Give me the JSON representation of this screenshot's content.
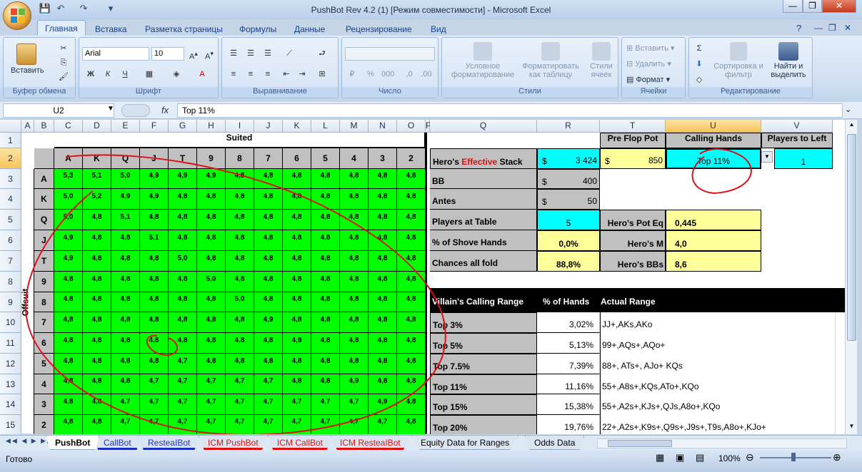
{
  "window": {
    "title": "PushBot Rev 4.2 (1)  [Режим совместимости] - Microsoft Excel"
  },
  "ribbon": {
    "tabs": [
      "Главная",
      "Вставка",
      "Разметка страницы",
      "Формулы",
      "Данные",
      "Рецензирование",
      "Вид"
    ],
    "groups": {
      "clipboard": {
        "label": "Буфер обмена",
        "paste": "Вставить"
      },
      "font": {
        "label": "Шрифт",
        "font_name": "Arial",
        "font_size": "10",
        "bold": "Ж",
        "italic": "К",
        "underline": "Ч"
      },
      "alignment": {
        "label": "Выравнивание"
      },
      "number": {
        "label": "Число"
      },
      "styles": {
        "label": "Стили",
        "conditional": "Условное форматирование",
        "table": "Форматировать как таблицу",
        "cell_styles": "Стили ячеек"
      },
      "cells": {
        "label": "Ячейки",
        "insert": "Вставить",
        "delete": "Удалить",
        "format": "Формат"
      },
      "editing": {
        "label": "Редактирование",
        "sort": "Сортировка и фильтр",
        "find": "Найти и выделить"
      }
    }
  },
  "formula_bar": {
    "name_box": "U2",
    "fx": "fx",
    "formula": "Top 11%"
  },
  "columns": [
    "A",
    "B",
    "C",
    "D",
    "E",
    "F",
    "G",
    "H",
    "I",
    "J",
    "K",
    "L",
    "M",
    "N",
    "O",
    "P",
    "Q",
    "R",
    "T",
    "U",
    "V"
  ],
  "rows": [
    "1",
    "2",
    "3",
    "4",
    "5",
    "6",
    "7",
    "8",
    "9",
    "10",
    "11",
    "12",
    "13",
    "14",
    "15"
  ],
  "grid": {
    "suited_label": "Suited",
    "offsuit_label": "Offsuit",
    "ranks": [
      "A",
      "K",
      "Q",
      "J",
      "T",
      "9",
      "8",
      "7",
      "6",
      "5",
      "4",
      "3",
      "2"
    ],
    "values": [
      [
        "5,3",
        "5,1",
        "5,0",
        "4,9",
        "4,9",
        "4,9",
        "4,8",
        "4,8",
        "4,8",
        "4,8",
        "4,8",
        "4,8",
        "4,8"
      ],
      [
        "5,0",
        "5,2",
        "4,9",
        "4,9",
        "4,8",
        "4,8",
        "4,8",
        "4,8",
        "4,8",
        "4,8",
        "4,8",
        "4,8",
        "4,8"
      ],
      [
        "5,0",
        "4,8",
        "5,1",
        "4,8",
        "4,8",
        "4,8",
        "4,8",
        "4,8",
        "4,8",
        "4,8",
        "4,8",
        "4,8",
        "4,8"
      ],
      [
        "4,9",
        "4,8",
        "4,8",
        "5,1",
        "4,8",
        "4,8",
        "4,8",
        "4,8",
        "4,8",
        "4,8",
        "4,8",
        "4,8",
        "4,8"
      ],
      [
        "4,9",
        "4,8",
        "4,8",
        "4,8",
        "5,0",
        "4,8",
        "4,8",
        "4,8",
        "4,8",
        "4,8",
        "4,8",
        "4,8",
        "4,8"
      ],
      [
        "4,8",
        "4,8",
        "4,8",
        "4,8",
        "4,8",
        "5,0",
        "4,8",
        "4,8",
        "4,8",
        "4,8",
        "4,8",
        "4,8",
        "4,8"
      ],
      [
        "4,8",
        "4,8",
        "4,8",
        "4,8",
        "4,8",
        "4,8",
        "5,0",
        "4,8",
        "4,8",
        "4,8",
        "4,8",
        "4,8",
        "4,8"
      ],
      [
        "4,8",
        "4,8",
        "4,8",
        "4,8",
        "4,8",
        "4,8",
        "4,8",
        "4,9",
        "4,8",
        "4,8",
        "4,8",
        "4,8",
        "4,8"
      ],
      [
        "4,8",
        "4,8",
        "4,8",
        "4,8",
        "4,8",
        "4,8",
        "4,8",
        "4,8",
        "4,9",
        "4,8",
        "4,8",
        "4,8",
        "4,8"
      ],
      [
        "4,8",
        "4,8",
        "4,8",
        "4,8",
        "4,7",
        "4,8",
        "4,8",
        "4,8",
        "4,8",
        "4,8",
        "4,8",
        "4,8",
        "4,8"
      ],
      [
        "4,8",
        "4,8",
        "4,8",
        "4,7",
        "4,7",
        "4,7",
        "4,7",
        "4,7",
        "4,8",
        "4,8",
        "4,9",
        "4,8",
        "4,8"
      ],
      [
        "4,8",
        "4,8",
        "4,7",
        "4,7",
        "4,7",
        "4,7",
        "4,7",
        "4,7",
        "4,7",
        "4,7",
        "4,7",
        "4,9",
        "4,8"
      ],
      [
        "4,8",
        "4,8",
        "4,7",
        "4,7",
        "4,7",
        "4,7",
        "4,7",
        "4,7",
        "4,7",
        "4,7",
        "4,7",
        "4,7",
        "4,8"
      ]
    ]
  },
  "panel": {
    "pre_flop_pot_header": "Pre Flop Pot",
    "calling_hands_header": "Calling Hands",
    "players_to_left_header": "Players to Left",
    "hero_stack_label_a": "Hero's",
    "hero_stack_label_b": "Effective",
    "hero_stack_label_c": "Stack",
    "currency": "$",
    "hero_stack": "3 424",
    "pot": "850",
    "calling_hands": "Top 11%",
    "players_to_left": "1",
    "bb_label": "BB",
    "bb": "400",
    "antes_label": "Antes",
    "antes": "50",
    "players_label": "Players at Table",
    "players": "5",
    "pot_eq_label": "Hero's Pot Eq",
    "pot_eq": "0,445",
    "shove_label": "% of Shove Hands",
    "shove": "0,0%",
    "m_label": "Hero's M",
    "m": "4,0",
    "fold_label": "Chances all fold",
    "fold": "88,8%",
    "bbs_label": "Hero's BBs",
    "bbs": "8,6",
    "range_header": "Villain's Calling Range",
    "pct_header": "% of Hands",
    "actual_header": "Actual Range",
    "ranges": [
      {
        "name": "Top 3%",
        "pct": "3,02%",
        "actual": "JJ+,AKs,AKo"
      },
      {
        "name": "Top 5%",
        "pct": "5,13%",
        "actual": "99+,AQs+,AQo+"
      },
      {
        "name": "Top 7.5%",
        "pct": "7,39%",
        "actual": "88+, ATs+, AJo+ KQs"
      },
      {
        "name": "Top 11%",
        "pct": "11,16%",
        "actual": "55+,A8s+,KQs,ATo+,KQo"
      },
      {
        "name": "Top 15%",
        "pct": "15,38%",
        "actual": "55+,A2s+,KJs+,QJs,A8o+,KQo"
      },
      {
        "name": "Top 20%",
        "pct": "19,76%",
        "actual": "22+,A2s+,K9s+,Q9s+,J9s+,T9s,A8o+,KJo+"
      }
    ]
  },
  "sheet_tabs": [
    "PushBot",
    "CallBot",
    "ResteaIBot",
    "ICM PushBot",
    "ICM CallBot",
    "ICM ResteaIBot",
    "Equity Data for Ranges",
    "Odds Data"
  ],
  "status": {
    "ready": "Готово",
    "zoom": "100%"
  },
  "colors": {
    "green": "#00ff00",
    "cyan": "#00ffff",
    "yellow": "#ffff99",
    "gray": "#c0c0c0",
    "red_ink": "#e0101a"
  }
}
